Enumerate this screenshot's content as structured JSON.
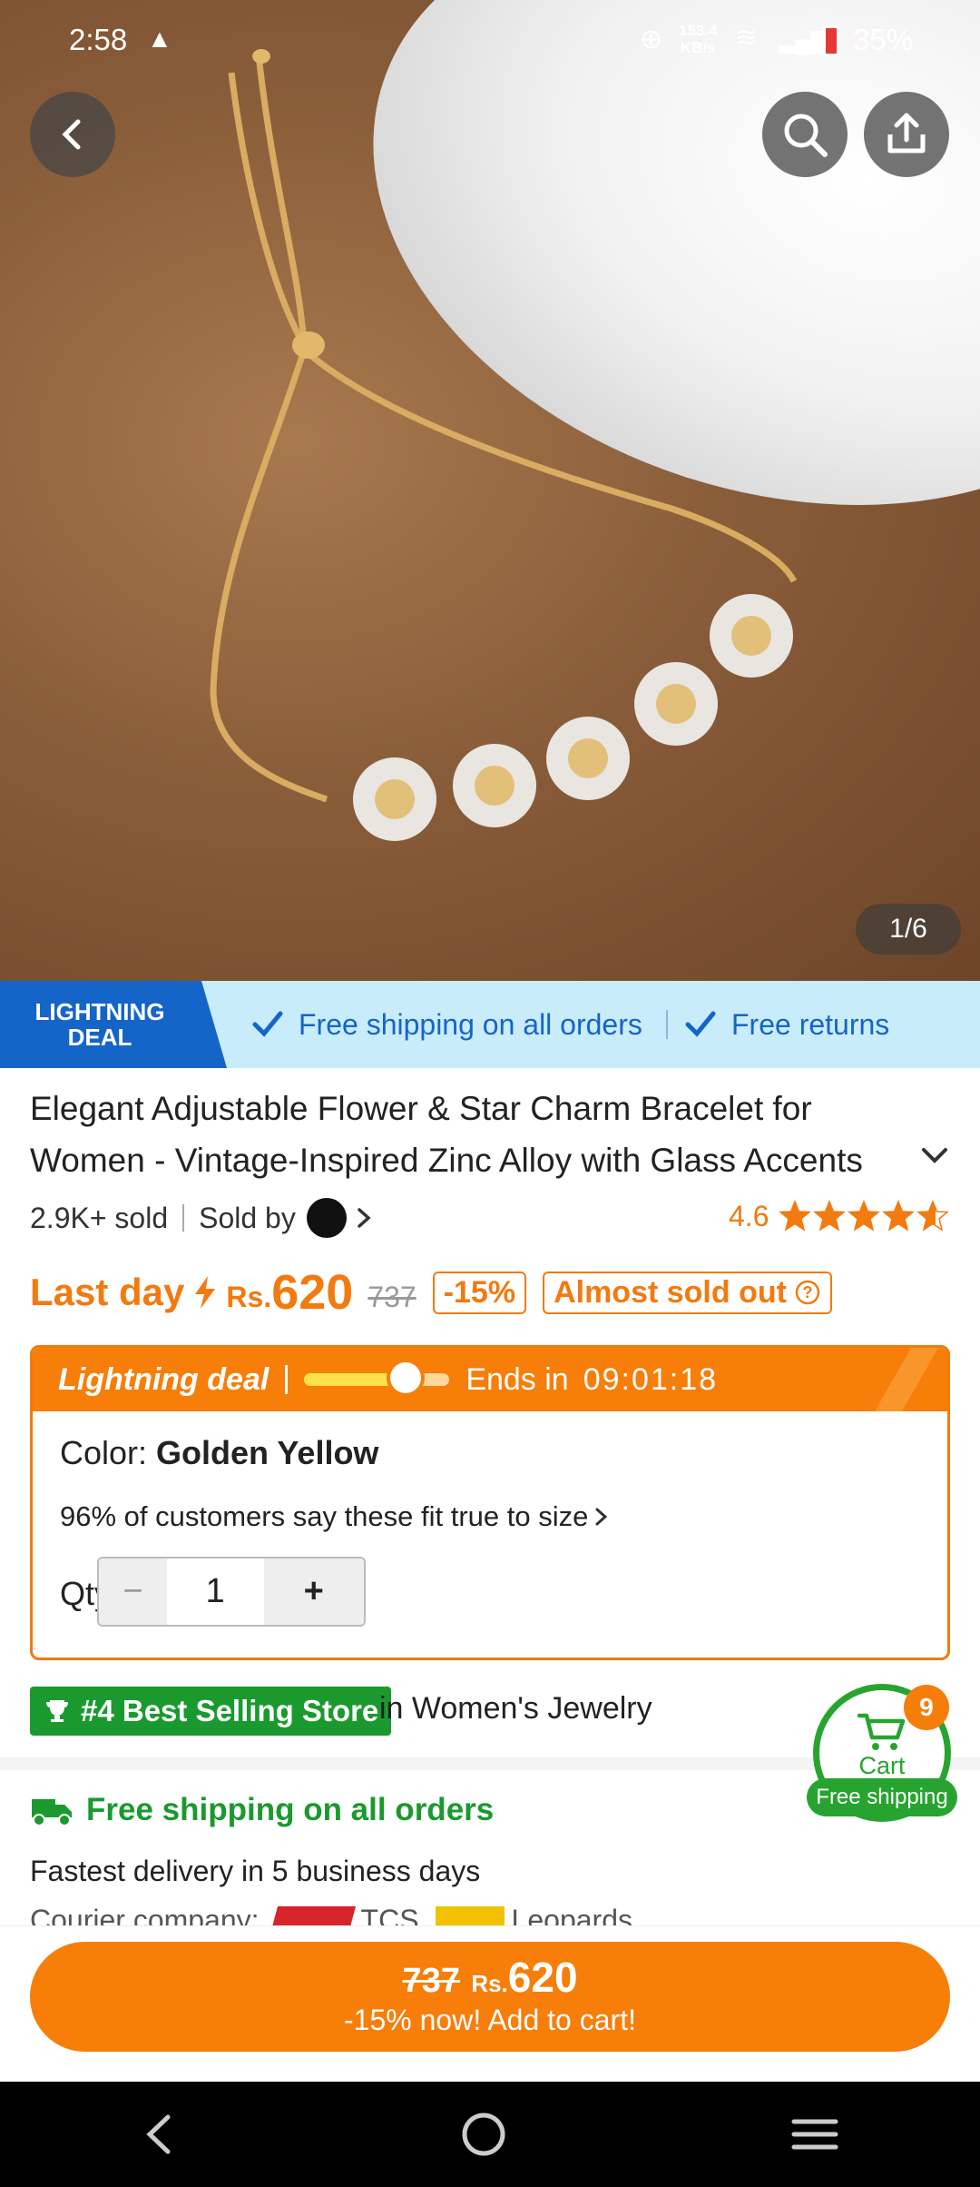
{
  "status": {
    "time": "2:58",
    "speed_value": "153.4",
    "speed_unit": "KB/s",
    "battery": "35%"
  },
  "hero": {
    "counter": "1/6"
  },
  "band": {
    "tag_line1": "LIGHTNING",
    "tag_line2": "DEAL",
    "item1": "Free shipping on all orders",
    "item2": "Free returns"
  },
  "product": {
    "title": "Elegant Adjustable Flower & Star Charm Bracelet for Women - Vintage-Inspired Zinc Alloy with Glass Accents",
    "sold": "2.9K+ sold",
    "sold_by": "Sold by",
    "rating": "4.6",
    "rating_value": 4.6
  },
  "price": {
    "last_day": "Last day",
    "currency": "Rs.",
    "amount": "620",
    "original": "737",
    "discount": "-15%",
    "almost": "Almost sold out"
  },
  "deal": {
    "label": "Lightning deal",
    "ends_in": "Ends in",
    "timer": "09:01:18",
    "progress": 0.7
  },
  "options": {
    "color_label": "Color:",
    "color_value": "Golden Yellow",
    "fit_text": "96% of customers say these fit true to size",
    "qty_label": "Qty",
    "qty_value": "1"
  },
  "store": {
    "badge": "#4 Best Selling Store",
    "category": "in Women's Jewelry"
  },
  "cart": {
    "count": "9",
    "label": "Cart",
    "shipping": "Free shipping"
  },
  "shipping": {
    "title": "Free shipping on all orders",
    "delivery": "Fastest delivery in 5 business days",
    "courier_label": "Courier company:",
    "courier1": "TCS",
    "courier2": "Leopards"
  },
  "cta": {
    "original": "737",
    "currency": "Rs.",
    "amount": "620",
    "sub": "-15% now! Add to cart!"
  },
  "colors": {
    "accent": "#f67e09",
    "green": "#27a42f",
    "blue": "#1565c8"
  }
}
